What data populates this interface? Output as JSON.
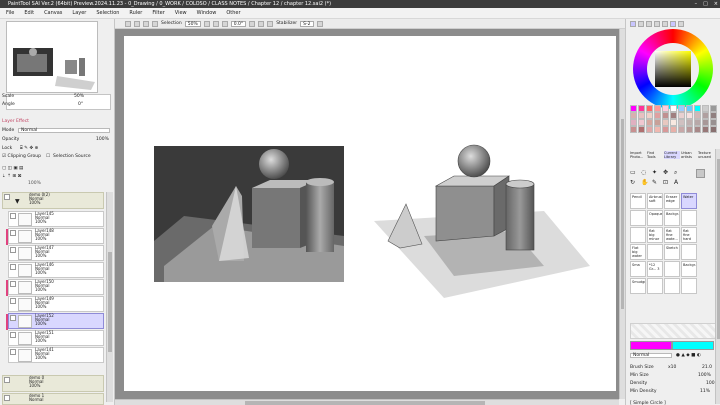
{
  "window": {
    "title": "PaintTool SAI Ver.2 (64bit) Preview.2024.11.23 - 0_Drawing / 0_WORK / COLOSO / CLASS NOTES / Chapter 12 / chapter 12.sai2 (*)",
    "controls": [
      "–",
      "□",
      "×"
    ]
  },
  "menu": [
    "File",
    "Edit",
    "Canvas",
    "Layer",
    "Selection",
    "Ruler",
    "Filter",
    "View",
    "Window",
    "Other"
  ],
  "toolbar": {
    "selection_label": "Selection",
    "zoom": "50%",
    "angle": "0.0°",
    "stabilizer_label": "Stabilizer",
    "stabilizer_value": "S-2"
  },
  "left_panel": {
    "scale_label": "Scale",
    "scale_value": "50%",
    "angle_label": "Angle",
    "angle_value": "0°",
    "layer_effect": "Layer Effect",
    "mode_label": "Mode",
    "mode_value": "Normal",
    "opacity_label": "Opacity",
    "opacity_value": "100%",
    "lock_label": "Lock",
    "clipping_group": "Clipping Group",
    "selection_source": "Selection Source",
    "top_percent": "100%",
    "group": {
      "name": "demo 0(2)",
      "mode": "Normal",
      "opacity": "100%"
    },
    "layers": [
      {
        "name": "Layer145",
        "mode": "Normal",
        "opacity": "100%"
      },
      {
        "name": "Layer148",
        "mode": "Normal",
        "opacity": "100%"
      },
      {
        "name": "Layer147",
        "mode": "Normal",
        "opacity": "100%"
      },
      {
        "name": "Layer146",
        "mode": "Normal",
        "opacity": "100%"
      },
      {
        "name": "Layer150",
        "mode": "Normal",
        "opacity": "100%"
      },
      {
        "name": "Layer149",
        "mode": "Normal",
        "opacity": "100%"
      },
      {
        "name": "Layer152",
        "mode": "Normal",
        "opacity": "100%"
      },
      {
        "name": "Layer151",
        "mode": "Normal",
        "opacity": "100%"
      },
      {
        "name": "Layer141",
        "mode": "Normal",
        "opacity": "100%"
      }
    ],
    "bottom_groups": [
      {
        "name": "demo 0",
        "mode": "Normal",
        "opacity": "100%"
      },
      {
        "name": "demo 1",
        "mode": "Normal",
        "opacity": "100%"
      }
    ]
  },
  "right_panel": {
    "tabs": [
      "Import Photo...",
      "Find Tools",
      "Current Library",
      "Urban artists",
      "Texture unused"
    ],
    "tools": [
      {
        "label": "Pencil"
      },
      {
        "label": "Airbrush soft"
      },
      {
        "label": "Eraser edge"
      },
      {
        "label": "Water"
      },
      {
        "label": ""
      },
      {
        "label": "Opaque...stor"
      },
      {
        "label": "Backgr..."
      },
      {
        "label": ""
      },
      {
        "label": ""
      },
      {
        "label": "flat big minor"
      },
      {
        "label": "flat fine wate..."
      },
      {
        "label": "flat fine hard"
      },
      {
        "label": "Flat big water"
      },
      {
        "label": ""
      },
      {
        "label": "Sketch"
      },
      {
        "label": ""
      },
      {
        "label": "Sma"
      },
      {
        "label": "*12 Gr... 3"
      },
      {
        "label": ""
      },
      {
        "label": "Backgr...detail"
      },
      {
        "label": "Smudge"
      },
      {
        "label": ""
      },
      {
        "label": ""
      },
      {
        "label": ""
      }
    ],
    "blend_mode": "Normal",
    "brush_size_label": "Brush Size",
    "brush_size_mult": "x10",
    "brush_size_value": "21.0",
    "min_size_label": "Min Size",
    "min_size_value": "100%",
    "density_label": "Density",
    "density_value": "100",
    "min_density_label": "Min Density",
    "min_density_value": "11%",
    "shape": "[ Simple Circle ]"
  },
  "colors": {
    "accent": "#8f8bd8",
    "fg": "#ff00ff",
    "bg": "#00ffff",
    "layer_flag": "#e0427f"
  }
}
